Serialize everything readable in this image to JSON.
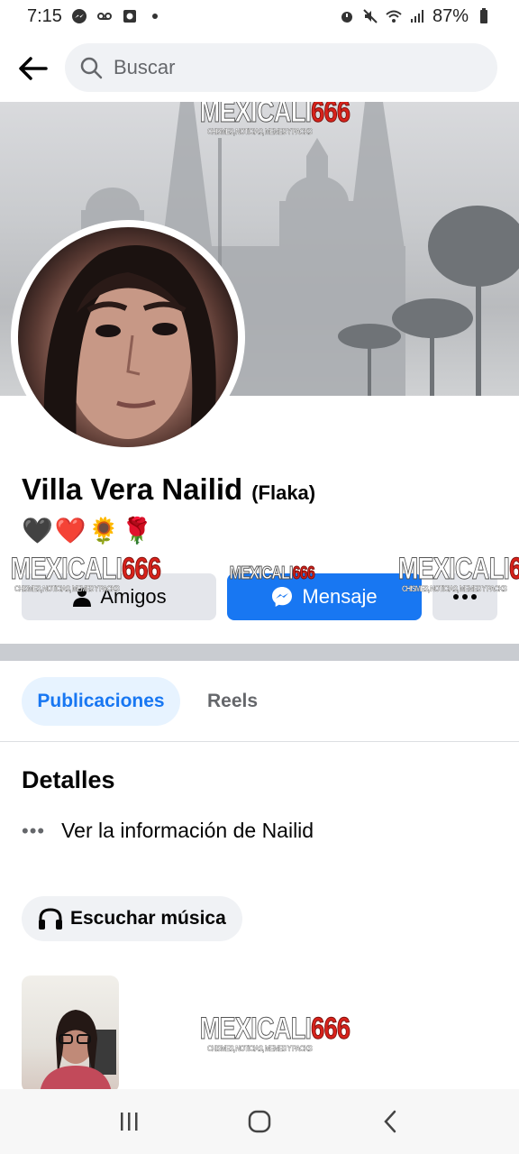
{
  "status_bar": {
    "time": "7:15",
    "battery": "87%"
  },
  "search": {
    "placeholder": "Buscar"
  },
  "watermark": {
    "brand_text": "MEXICALI",
    "brand_number": "666",
    "tagline": "CHISMES, NOTICIAS, MEMES Y PACKS"
  },
  "profile": {
    "name": "Villa Vera Nailid",
    "alternate_name": "(Flaka)",
    "bio": "🖤❤️🌻🌹"
  },
  "actions": {
    "friends_label": "Amigos",
    "message_label": "Mensaje"
  },
  "tabs": [
    {
      "label": "Publicaciones",
      "active": true
    },
    {
      "label": "Reels",
      "active": false
    }
  ],
  "details": {
    "title": "Detalles",
    "info_link": "Ver la información de Nailid"
  },
  "music": {
    "label": "Escuchar música"
  },
  "colors": {
    "accent": "#1877f2",
    "tab_active_bg": "#e7f3ff",
    "watermark_red": "#d8221b"
  }
}
